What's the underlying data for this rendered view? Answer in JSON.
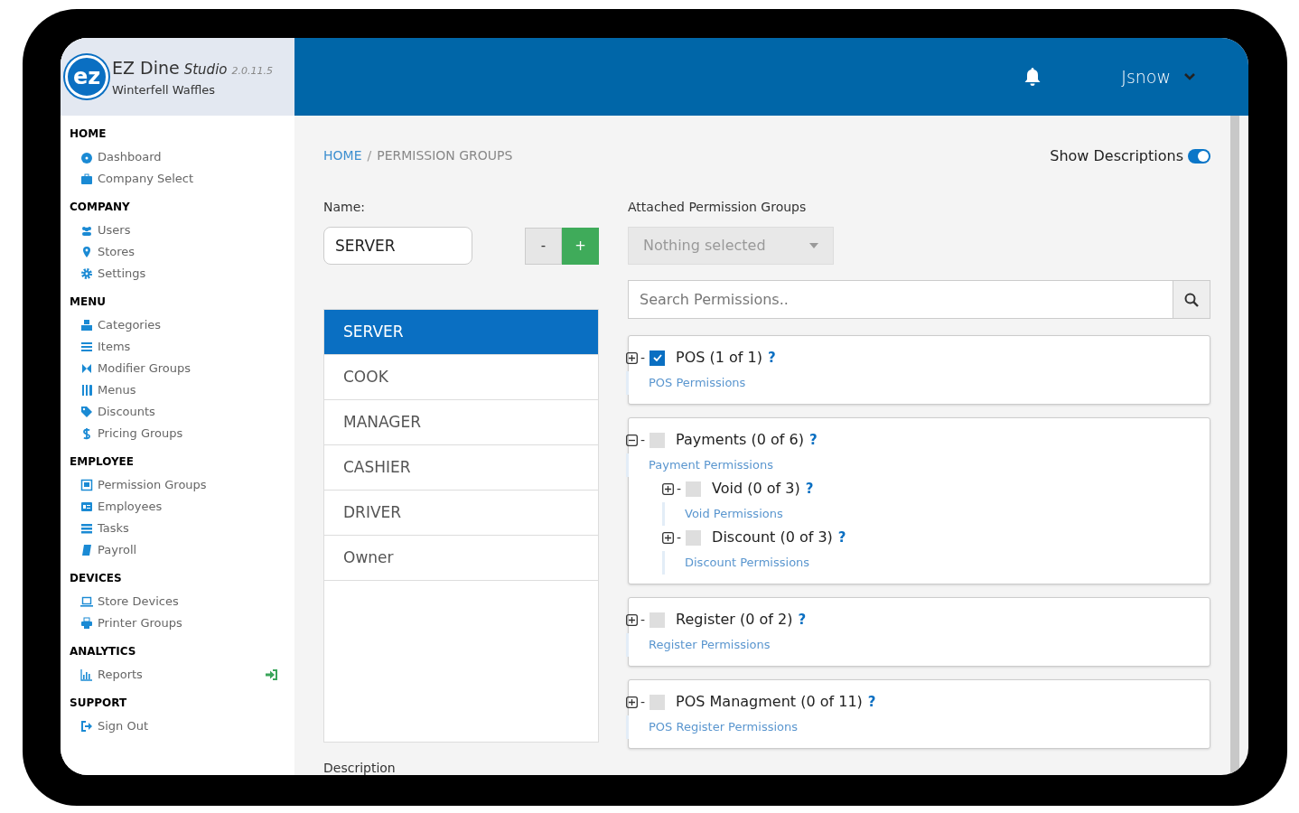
{
  "app": {
    "logo": "ez",
    "title": "EZ Dine",
    "subtitle": "Studio",
    "version": "2.0.11.5",
    "company": "Winterfell Waffles"
  },
  "header": {
    "user": "Jsnow"
  },
  "sidebar": [
    {
      "heading": "HOME",
      "items": [
        {
          "label": "Dashboard"
        },
        {
          "label": "Company Select"
        }
      ]
    },
    {
      "heading": "COMPANY",
      "items": [
        {
          "label": "Users"
        },
        {
          "label": "Stores"
        },
        {
          "label": "Settings"
        }
      ]
    },
    {
      "heading": "MENU",
      "items": [
        {
          "label": "Categories"
        },
        {
          "label": "Items"
        },
        {
          "label": "Modifier Groups"
        },
        {
          "label": "Menus"
        },
        {
          "label": "Discounts"
        },
        {
          "label": "Pricing Groups"
        }
      ]
    },
    {
      "heading": "EMPLOYEE",
      "items": [
        {
          "label": "Permission Groups"
        },
        {
          "label": "Employees"
        },
        {
          "label": "Tasks"
        },
        {
          "label": "Payroll"
        }
      ]
    },
    {
      "heading": "DEVICES",
      "items": [
        {
          "label": "Store Devices"
        },
        {
          "label": "Printer Groups"
        }
      ]
    },
    {
      "heading": "ANALYTICS",
      "items": [
        {
          "label": "Reports",
          "kind": "external"
        }
      ]
    },
    {
      "heading": "SUPPORT",
      "items": [
        {
          "label": "Sign Out"
        }
      ]
    }
  ],
  "breadcrumb": [
    "HOME",
    "PERMISSION GROUPS"
  ],
  "breadcrumb_separator": "/",
  "show_descriptions": {
    "label": "Show Descriptions",
    "on": true
  },
  "name_field": {
    "label": "Name:",
    "value": "SERVER",
    "buttons": [
      "-",
      "+"
    ]
  },
  "groups": [
    {
      "label": "SERVER",
      "selected": true
    },
    {
      "label": "COOK",
      "selected": false
    },
    {
      "label": "MANAGER",
      "selected": false
    },
    {
      "label": "CASHIER",
      "selected": false
    },
    {
      "label": "DRIVER",
      "selected": false
    },
    {
      "label": "Owner",
      "selected": false
    }
  ],
  "attached": {
    "label": "Attached Permission Groups",
    "placeholder": "Nothing selected"
  },
  "search": {
    "placeholder": "Search Permissions.."
  },
  "permissions": [
    {
      "title": "POS (1 of 1)",
      "help": "?",
      "dash": "-",
      "checked": true,
      "expanded": false,
      "description": "POS Permissions"
    },
    {
      "title": "Payments (0 of 6)",
      "help": "?",
      "dash": "-",
      "checked": false,
      "expanded": true,
      "description": "Payment Permissions",
      "children": [
        {
          "title": "Void (0 of 3)",
          "help": "?",
          "dash": "-",
          "checked": false,
          "expanded": false,
          "description": "Void Permissions"
        },
        {
          "title": "Discount (0 of 3)",
          "help": "?",
          "dash": "-",
          "checked": false,
          "expanded": false,
          "description": "Discount Permissions"
        }
      ]
    },
    {
      "title": "Register (0 of 2)",
      "help": "?",
      "dash": "-",
      "checked": false,
      "expanded": false,
      "description": "Register Permissions"
    },
    {
      "title": "POS Managment (0 of 11)",
      "help": "?",
      "dash": "-",
      "checked": false,
      "expanded": false,
      "description": "POS Register Permissions"
    }
  ],
  "description_label": "Description"
}
